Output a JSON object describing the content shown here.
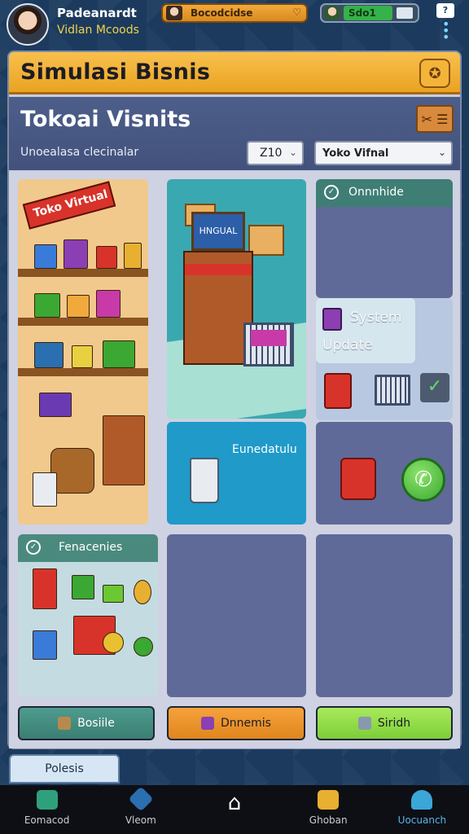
{
  "header": {
    "player_name": "Padeanardt",
    "player_mode": "Vidlan Mcoods",
    "coin_label": "Bocodcidse",
    "stat_value": "Sdo1",
    "notif_glyph": "?"
  },
  "panel": {
    "title": "Simulasi Bisnis",
    "shop_name": "Tokoai Visnits",
    "sub_label": "Unoealasa clecinalar",
    "qty_value": "Z10",
    "shop_select": "Yoko Vifnal"
  },
  "tiles": {
    "shelf_sign": "Toko Virtual",
    "kiosk_screen": "HNGUAL",
    "online_title": "Onnnhide",
    "system_line1": "System",
    "system_line2": "Update",
    "sale_label": "Eunedatulu",
    "finance_title": "Fenacenies"
  },
  "buttons": {
    "b1": "Bosiile",
    "b2": "Dnnemis",
    "b3": "Siridh"
  },
  "bottom": {
    "progress_label": "Polesis",
    "nav": [
      {
        "label": "Eomacod",
        "icon": "home-app-icon"
      },
      {
        "label": "Vleom",
        "icon": "diamond-icon"
      },
      {
        "label": "",
        "icon": "home-icon"
      },
      {
        "label": "Ghoban",
        "icon": "folder-icon"
      },
      {
        "label": "Uocuanch",
        "icon": "cloud-icon"
      }
    ]
  },
  "colors": {
    "accent_orange": "#eaa322",
    "panel_blue": "#4d5e8a",
    "teal": "#3f7e74",
    "green": "#7dce38",
    "background": "#1b3a5e"
  }
}
